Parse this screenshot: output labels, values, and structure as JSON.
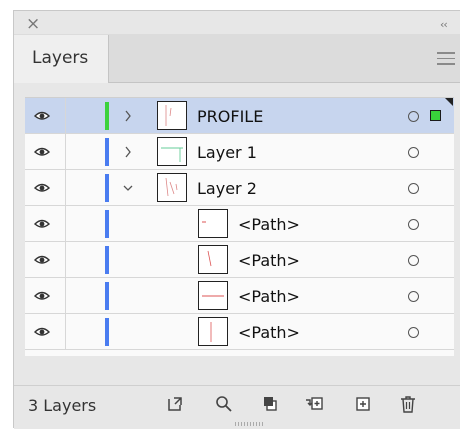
{
  "window": {
    "close_glyph": "×",
    "collapse_glyph": "‹‹"
  },
  "panel": {
    "tab_label": "Layers"
  },
  "layers": [
    {
      "name": "PROFILE",
      "expanded": false,
      "selected": true,
      "color": "#3cd23c",
      "indent": 0,
      "has_chevron": true
    },
    {
      "name": "Layer 1",
      "expanded": false,
      "selected": false,
      "color": "#4a7cf0",
      "indent": 0,
      "has_chevron": true
    },
    {
      "name": "Layer 2",
      "expanded": true,
      "selected": false,
      "color": "#4a7cf0",
      "indent": 0,
      "has_chevron": true
    },
    {
      "name": "<Path>",
      "expanded": false,
      "selected": false,
      "color": "#4a7cf0",
      "indent": 1,
      "has_chevron": false
    },
    {
      "name": "<Path>",
      "expanded": false,
      "selected": false,
      "color": "#4a7cf0",
      "indent": 1,
      "has_chevron": false
    },
    {
      "name": "<Path>",
      "expanded": false,
      "selected": false,
      "color": "#4a7cf0",
      "indent": 1,
      "has_chevron": false
    },
    {
      "name": "<Path>",
      "expanded": false,
      "selected": false,
      "color": "#4a7cf0",
      "indent": 1,
      "has_chevron": false
    }
  ],
  "footer": {
    "layer_count": "3 Layers",
    "tools": [
      "export-icon",
      "search-icon",
      "clipping-mask-icon",
      "sublayer-icon",
      "new-layer-icon",
      "trash-icon"
    ]
  },
  "colors": {
    "selection_bg": "#c7d5ee",
    "selected_art": "#39d33b",
    "layer_blue": "#4a7cf0"
  }
}
